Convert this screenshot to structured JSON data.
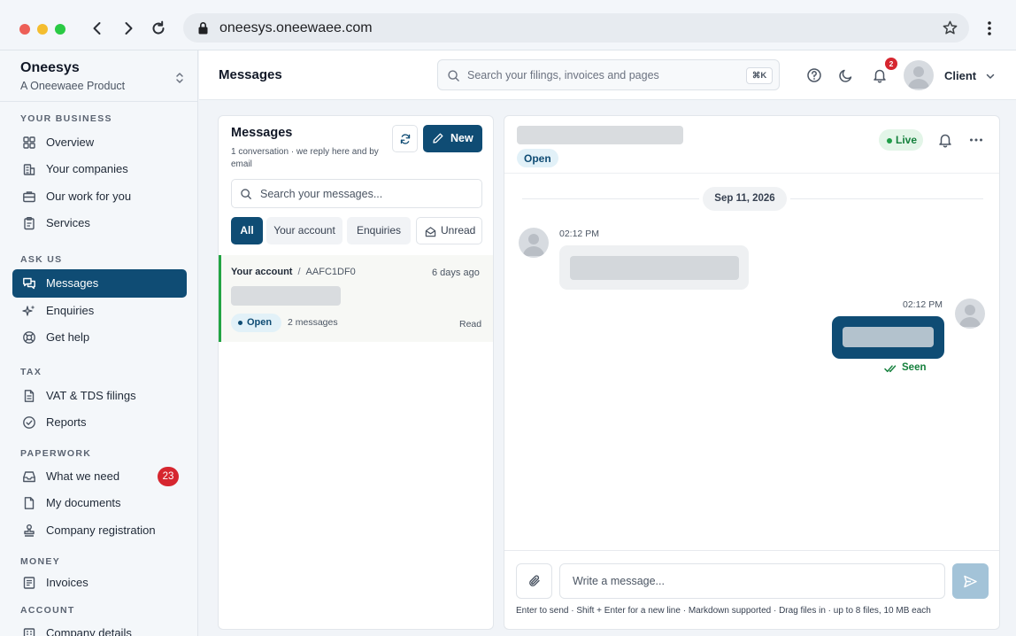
{
  "browser": {
    "url": "oneesys.oneewaee.com",
    "controls": [
      "close",
      "minimize",
      "maximize"
    ],
    "colors": {
      "close": "#ed5f57",
      "minimize": "#f4bd2f",
      "maximize": "#2aca44"
    }
  },
  "sidebar": {
    "brand": "Oneesys",
    "brand_sub": "A Oneewaee Product",
    "sections": {
      "your_business": "YOUR BUSINESS",
      "ask_us": "ASK US",
      "tax": "TAX",
      "paperwork": "PAPERWORK",
      "money": "MONEY",
      "account": "ACCOUNT"
    },
    "items": {
      "overview": "Overview",
      "companies": "Your companies",
      "our_work": "Our work for you",
      "services": "Services",
      "messages": "Messages",
      "enquiries": "Enquiries",
      "get_help": "Get help",
      "vat": "VAT & TDS filings",
      "reports": "Reports",
      "what_we_need": "What we need",
      "what_we_need_badge": "23",
      "my_documents": "My documents",
      "company_registration": "Company registration",
      "invoices": "Invoices",
      "company_details": "Company details"
    },
    "active_color": "#0f4c74"
  },
  "header": {
    "title": "Messages",
    "search_placeholder": "Search your filings, invoices and pages",
    "search_shortcut": "⌘K",
    "notification_count": "2",
    "user": "Client"
  },
  "list": {
    "title": "Messages",
    "subtitle": "1 conversation · we reply here and by email",
    "new_label": "New",
    "search_placeholder": "Search your messages...",
    "filters": {
      "all": "All",
      "account": "Your account",
      "enquiries": "Enquiries",
      "unread": "Unread"
    },
    "conversation": {
      "category": "Your account",
      "separator": "/",
      "id": "AAFC1DF0",
      "time": "6 days ago",
      "status": "Open",
      "count": "2 messages",
      "read_state": "Read"
    }
  },
  "thread": {
    "status": "Open",
    "live": "Live",
    "date": "Sep 11, 2026",
    "incoming_time": "02:12 PM",
    "outgoing_time": "02:12 PM",
    "seen": "Seen",
    "composer_placeholder": "Write a message...",
    "hint": "Enter to send · Shift + Enter for a new line · Markdown supported · Drag files in · up to 8 files, 10 MB each"
  }
}
